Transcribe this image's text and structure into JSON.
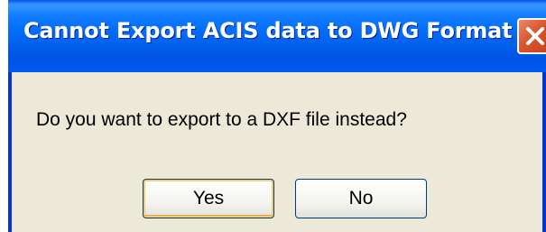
{
  "window": {
    "title": "Cannot Export ACIS data to DWG Format",
    "close_icon": "close-x-icon"
  },
  "message": "Do you want to export to a DXF file instead?",
  "buttons": {
    "yes_label": "Yes",
    "no_label": "No"
  },
  "colors": {
    "title_bar": "#0054E3",
    "dialog_face": "#ECE9D8",
    "close_button": "#D9552E",
    "default_button_focus": "#F9C96A"
  }
}
